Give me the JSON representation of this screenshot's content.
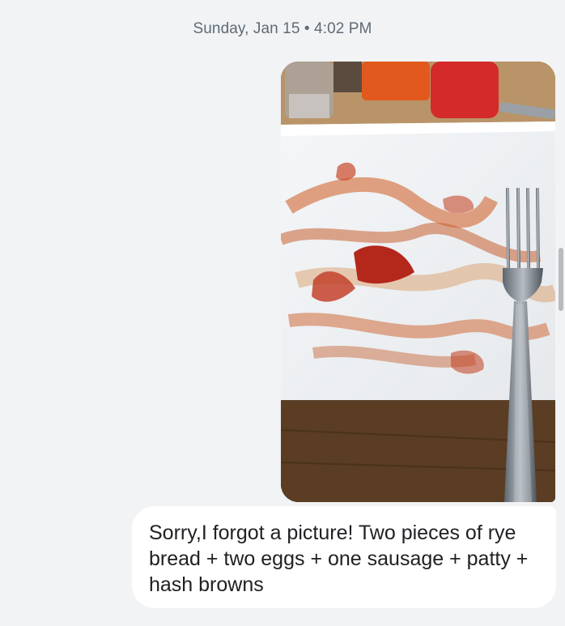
{
  "conversation": {
    "timestamp": "Sunday, Jan 15 • 4:02 PM",
    "messages": [
      {
        "type": "image",
        "subject": "empty plate with ketchup smears and a fork"
      },
      {
        "type": "text",
        "text": "Sorry,I forgot a picture! Two pieces of rye bread + two eggs + one sausage + patty + hash browns"
      }
    ]
  },
  "colors": {
    "background": "#f1f3f4",
    "bubble": "#ffffff",
    "timestamp_text": "#5f6b76",
    "message_text": "#202124"
  }
}
